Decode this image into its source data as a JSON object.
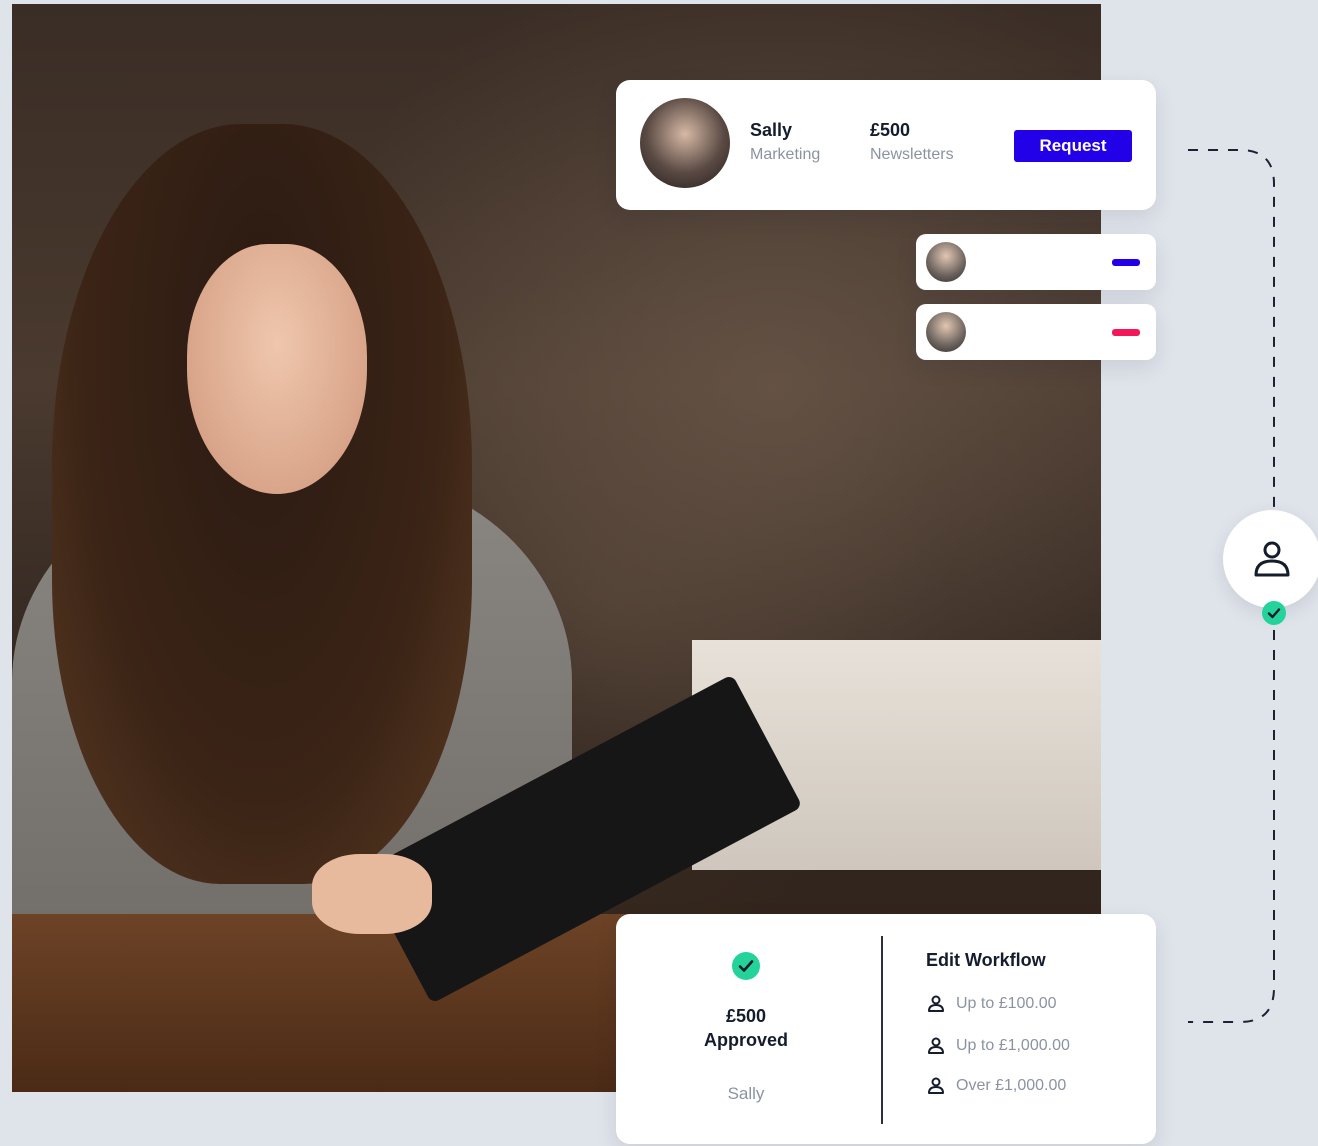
{
  "request_card": {
    "name": "Sally",
    "department": "Marketing",
    "amount": "£500",
    "category": "Newsletters",
    "request_button": "Request"
  },
  "approvers": [
    {
      "indicator_color": "#2200e8"
    },
    {
      "indicator_color": "#f2185a"
    }
  ],
  "approved_card": {
    "amount": "£500",
    "status": "Approved",
    "approver": "Sally",
    "workflow": {
      "title": "Edit Workflow",
      "rules": [
        {
          "icon": "user-icon",
          "label": "Up to £100.00"
        },
        {
          "icon": "user-icon",
          "label": "Up to £1,000.00"
        },
        {
          "icon": "user-icon",
          "label": "Over £1,000.00"
        }
      ]
    }
  },
  "colors": {
    "accent": "#2200e8",
    "success": "#24d39a",
    "danger": "#f2185a"
  }
}
